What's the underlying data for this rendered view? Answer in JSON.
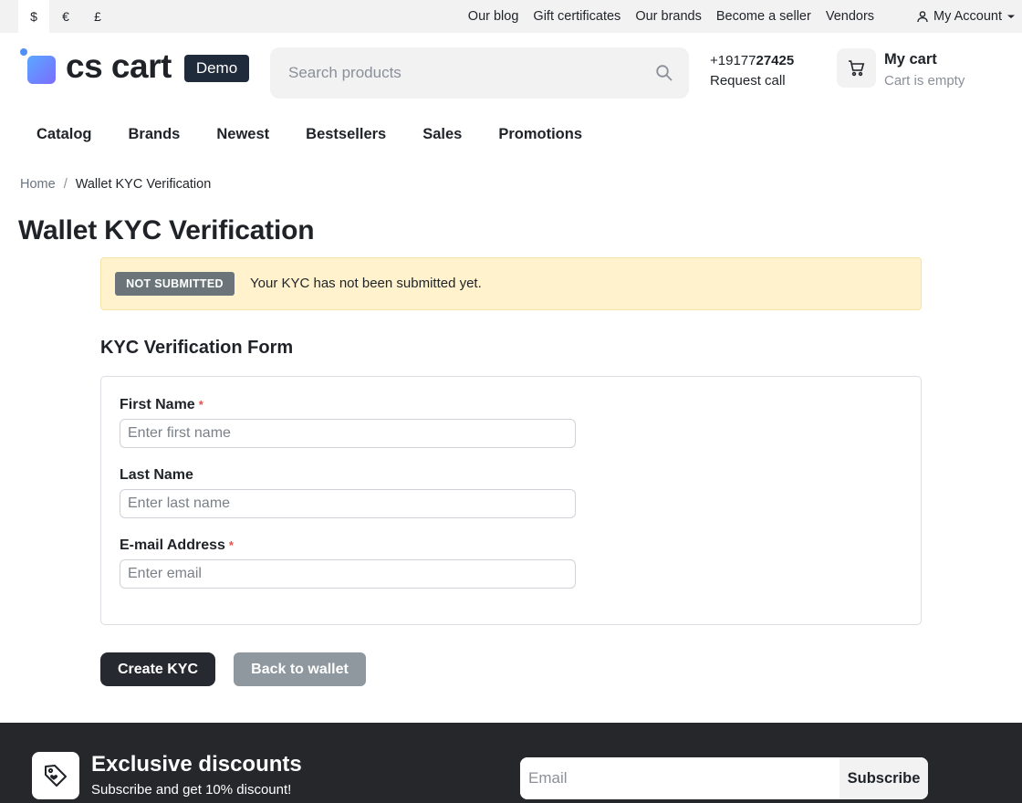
{
  "topbar": {
    "currencies": [
      "$",
      "€",
      "£"
    ],
    "links": [
      "Our blog",
      "Gift certificates",
      "Our brands",
      "Become a seller",
      "Vendors"
    ],
    "account_label": "My Account"
  },
  "header": {
    "logo_text": "cs cart",
    "logo_badge": "Demo",
    "search_placeholder": "Search products",
    "phone_prefix": "+19177",
    "phone_bold": "27425",
    "request_call": "Request call",
    "cart_title": "My cart",
    "cart_status": "Cart is empty"
  },
  "nav": {
    "items": [
      "Catalog",
      "Brands",
      "Newest",
      "Bestsellers",
      "Sales",
      "Promotions"
    ]
  },
  "breadcrumb": {
    "home": "Home",
    "separator": "/",
    "current": "Wallet KYC Verification"
  },
  "page": {
    "title": "Wallet KYC Verification"
  },
  "alert": {
    "badge": "NOT SUBMITTED",
    "message": "Your KYC has not been submitted yet."
  },
  "form": {
    "title": "KYC Verification Form",
    "required_mark": "*",
    "first_name": {
      "label": "First Name",
      "placeholder": "Enter first name",
      "value": ""
    },
    "last_name": {
      "label": "Last Name",
      "placeholder": "Enter last name",
      "value": ""
    },
    "email": {
      "label": "E-mail Address",
      "placeholder": "Enter email",
      "value": ""
    }
  },
  "buttons": {
    "create": "Create KYC",
    "back": "Back to wallet"
  },
  "footer": {
    "promo_title": "Exclusive discounts",
    "promo_subtitle": "Subscribe and get 10% discount!",
    "email_placeholder": "Email",
    "subscribe": "Subscribe"
  },
  "colors": {
    "brand_dark": "#262a30",
    "alert_bg": "#fff2cc",
    "badge_gray": "#6b7579",
    "required_red": "#e5534b",
    "footer_bg": "#26272b"
  }
}
